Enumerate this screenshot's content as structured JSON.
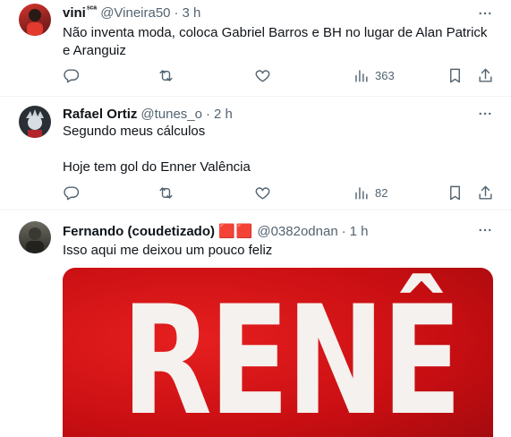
{
  "tweets": [
    {
      "name": "vini",
      "name_suffix": "ˢᶜᵃ",
      "handle": "@Vineira50",
      "separator": "·",
      "time": "3 h",
      "text": "Não inventa moda, coloca Gabriel Barros e BH no lugar de Alan Patrick e Aranguiz",
      "views": "363",
      "avatar_colors": [
        "#7c1e1e",
        "#d8342b"
      ]
    },
    {
      "name": "Rafael Ortiz",
      "handle": "@tunes_o",
      "separator": "·",
      "time": "2 h",
      "text": "Segundo meus cálculos\n\nHoje tem gol do Enner Valência",
      "views": "82",
      "avatar_colors": [
        "#2a2f36",
        "#b9c3cc"
      ]
    },
    {
      "name": "Fernando (coudetizado)",
      "badges": "🟥🟥",
      "handle": "@0382odnan",
      "separator": "·",
      "time": "1 h",
      "text": "Isso aqui me deixou um pouco feliz",
      "media_text": "RENÊ",
      "avatar_colors": [
        "#3b3a35",
        "#8a8a7e"
      ]
    }
  ],
  "icons": {
    "reply": "reply-icon",
    "retweet": "retweet-icon",
    "like": "heart-icon",
    "views": "views-icon",
    "bookmark": "bookmark-icon",
    "share": "share-icon",
    "more": "more-icon"
  },
  "colors": {
    "text": "#0f1419",
    "secondary": "#536471",
    "divider": "#eff3f4",
    "media_red": "#c80e12"
  }
}
